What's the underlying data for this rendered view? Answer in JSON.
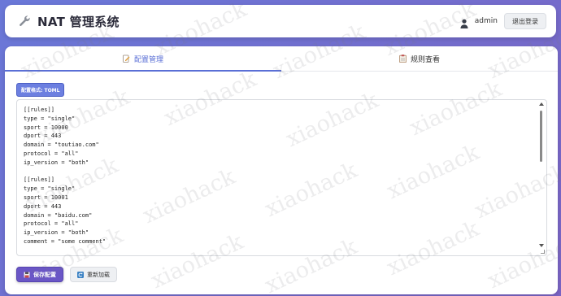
{
  "header": {
    "title": "NAT 管理系统",
    "brand_icon": "wrench-icon",
    "user_icon": "user-icon",
    "username": "admin",
    "logout_label": "退出登录"
  },
  "tabs": [
    {
      "label": "配置管理",
      "icon": "edit-icon",
      "active": true
    },
    {
      "label": "规则查看",
      "icon": "clipboard-icon",
      "active": false
    }
  ],
  "config": {
    "format_badge": "配置格式: TOML",
    "content": "[[rules]]\ntype = \"single\"\nsport = 10000\ndport = 443\ndomain = \"toutiao.com\"\nprotocol = \"all\"\nip_version = \"both\"\n\n[[rules]]\ntype = \"single\"\nsport = 10001\ndport = 443\ndomain = \"baidu.com\"\nprotocol = \"all\"\nip_version = \"both\"\ncomment = \"some comment\""
  },
  "actions": {
    "save_label": "保存配置",
    "save_icon": "save-icon",
    "reload_label": "重新加载",
    "reload_icon": "refresh-icon"
  },
  "watermark": {
    "text": "xiaohack"
  },
  "colors": {
    "accent": "#5a6fd6",
    "save_button": "#6a56c6",
    "background_start": "#6a78d8",
    "background_end": "#7b64c4"
  }
}
